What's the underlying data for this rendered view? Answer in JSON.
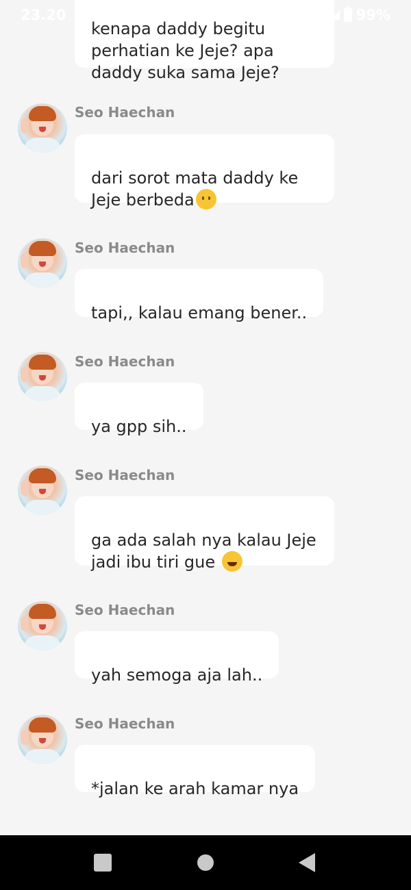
{
  "status": {
    "time": "23.20",
    "battery": "99%"
  },
  "messages": [
    {
      "sender": "",
      "text": "kenapa daddy begitu\nperhatian ke Jeje? apa\ndaddy suka sama Jeje?",
      "emoji": ""
    },
    {
      "sender": "Seo Haechan",
      "text": "dari sorot mata daddy ke\nJeje berbeda",
      "emoji": "neutral-face-icon"
    },
    {
      "sender": "Seo Haechan",
      "text": "tapi,, kalau emang bener..",
      "emoji": ""
    },
    {
      "sender": "Seo Haechan",
      "text": "ya gpp sih..",
      "emoji": ""
    },
    {
      "sender": "Seo Haechan",
      "text": "ga ada salah nya kalau Jeje\njadi ibu tiri gue ",
      "emoji": "laughing-face-icon"
    },
    {
      "sender": "Seo Haechan",
      "text": "yah semoga aja lah..",
      "emoji": ""
    },
    {
      "sender": "Seo Haechan",
      "text": "*jalan ke arah kamar nya",
      "emoji": ""
    }
  ],
  "navigation": {
    "buttons": [
      "recent-apps",
      "home",
      "back"
    ]
  }
}
